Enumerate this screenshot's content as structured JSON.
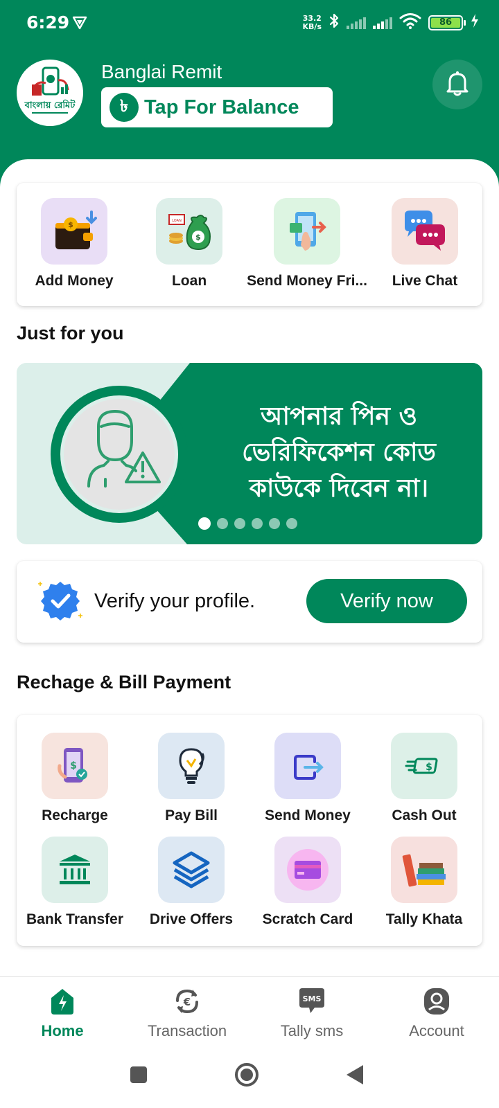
{
  "status_bar": {
    "time": "6:29",
    "net_speed_value": "33.2",
    "net_speed_unit": "KB/s",
    "battery": "86"
  },
  "header": {
    "app_name": "Banglai Remit",
    "balance_button": "Tap For Balance",
    "taka_symbol": "৳",
    "logo_text": "বাংলায় রেমিট"
  },
  "quick_actions": [
    {
      "label": "Add Money",
      "icon": "wallet-icon",
      "bg": "#E9DEF6"
    },
    {
      "label": "Loan",
      "icon": "money-bag-icon",
      "bg": "#DDEFE9"
    },
    {
      "label": "Send Money Fri...",
      "icon": "phone-transfer-icon",
      "bg": "#DDF5E2"
    },
    {
      "label": "Live Chat",
      "icon": "chat-bubbles-icon",
      "bg": "#F6E2DE"
    }
  ],
  "just_for_you": {
    "title": "Just for you",
    "banner_line1": "আপনার পিন ও",
    "banner_line2": "ভেরিফিকেশন কোড",
    "banner_line3": "কাউকে দিবেন না।",
    "slide_count": 6,
    "active_slide": 1
  },
  "verify": {
    "text": "Verify your profile.",
    "button": "Verify now"
  },
  "bill_payment": {
    "title": "Rechage & Bill Payment",
    "items": [
      {
        "label": "Recharge",
        "icon": "mobile-recharge-icon",
        "bg": "#F7E4DE"
      },
      {
        "label": "Pay Bill",
        "icon": "bulb-icon",
        "bg": "#DDE8F3"
      },
      {
        "label": "Send Money",
        "icon": "send-money-icon",
        "bg": "#DDDDF7"
      },
      {
        "label": "Cash Out",
        "icon": "cash-out-icon",
        "bg": "#DDF0E8"
      },
      {
        "label": "Bank Transfer",
        "icon": "bank-icon",
        "bg": "#DDEFE9"
      },
      {
        "label": "Drive Offers",
        "icon": "layers-icon",
        "bg": "#DDE8F3"
      },
      {
        "label": "Scratch Card",
        "icon": "card-icon",
        "bg": "#EDE0F5"
      },
      {
        "label": "Tally Khata",
        "icon": "books-icon",
        "bg": "#F7E0DE"
      }
    ]
  },
  "bottom_nav": [
    {
      "label": "Home",
      "icon": "home-icon",
      "active": true
    },
    {
      "label": "Transaction",
      "icon": "transaction-icon",
      "active": false
    },
    {
      "label": "Tally sms",
      "icon": "sms-icon",
      "active": false
    },
    {
      "label": "Account",
      "icon": "account-icon",
      "active": false
    }
  ],
  "sms_icon_text": "SMS",
  "colors": {
    "brand": "#00875A",
    "header_bg": "#00875A",
    "verify_badge": "#2F80ED"
  }
}
